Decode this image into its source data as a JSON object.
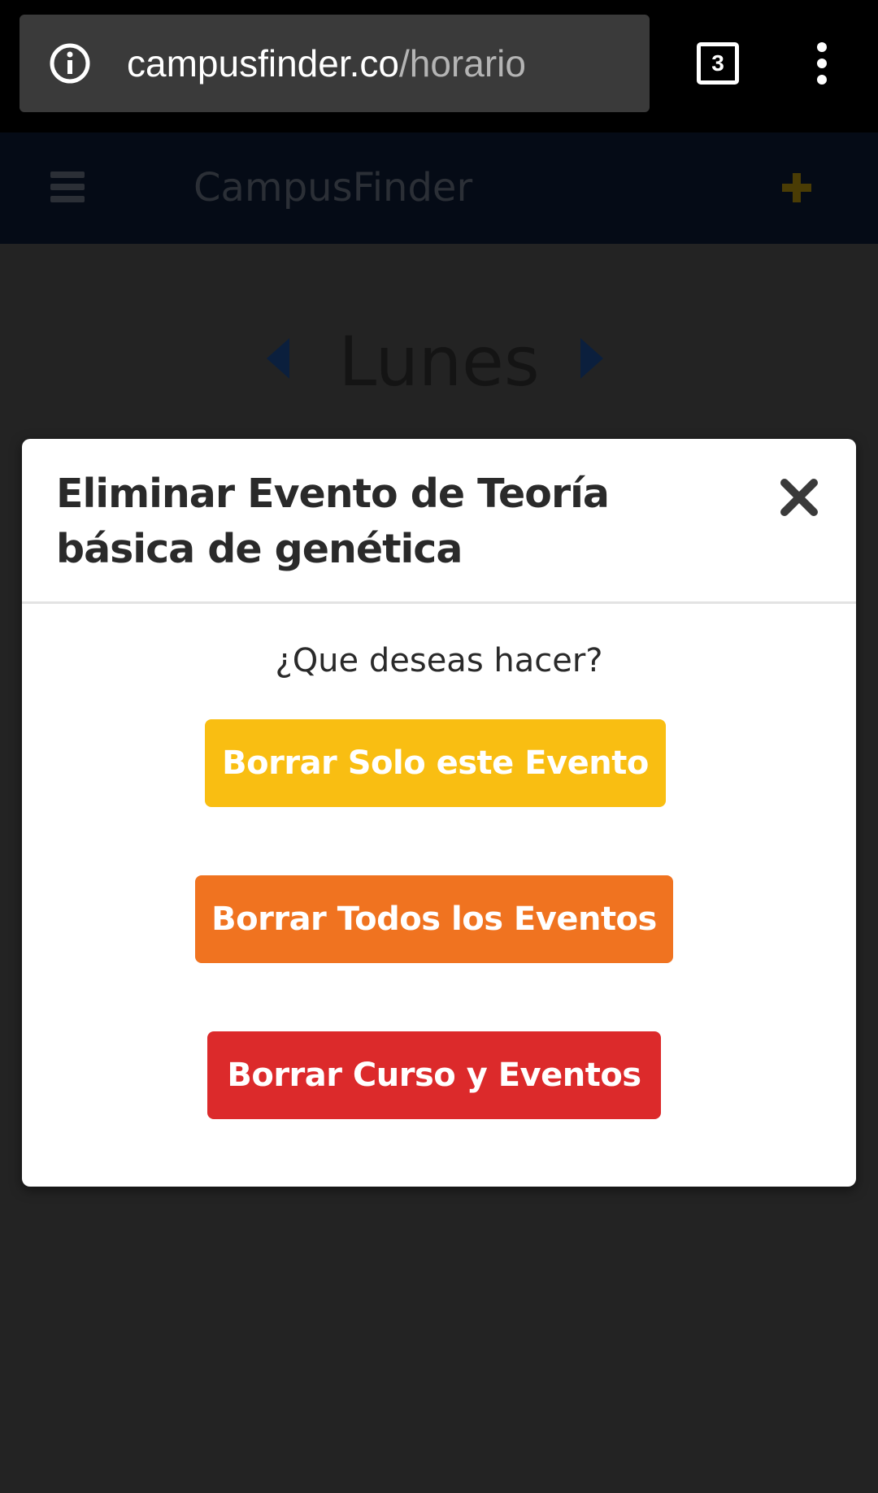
{
  "browser": {
    "url_host": "campusfinder.co",
    "url_path": "/horario",
    "tab_count": "3"
  },
  "app": {
    "brand": "CampusFinder",
    "day": "Lunes"
  },
  "modal": {
    "title": "Eliminar Evento de Teoría básica de genética",
    "question": "¿Que deseas hacer?",
    "buttons": {
      "solo": "Borrar Solo este Evento",
      "todos": "Borrar Todos los Eventos",
      "curso": "Borrar Curso y Eventos"
    }
  },
  "colors": {
    "solo": "#f9be12",
    "todos": "#f07320",
    "curso": "#dc2a2b",
    "navbar": "#050b16",
    "overlay": "#232323"
  }
}
